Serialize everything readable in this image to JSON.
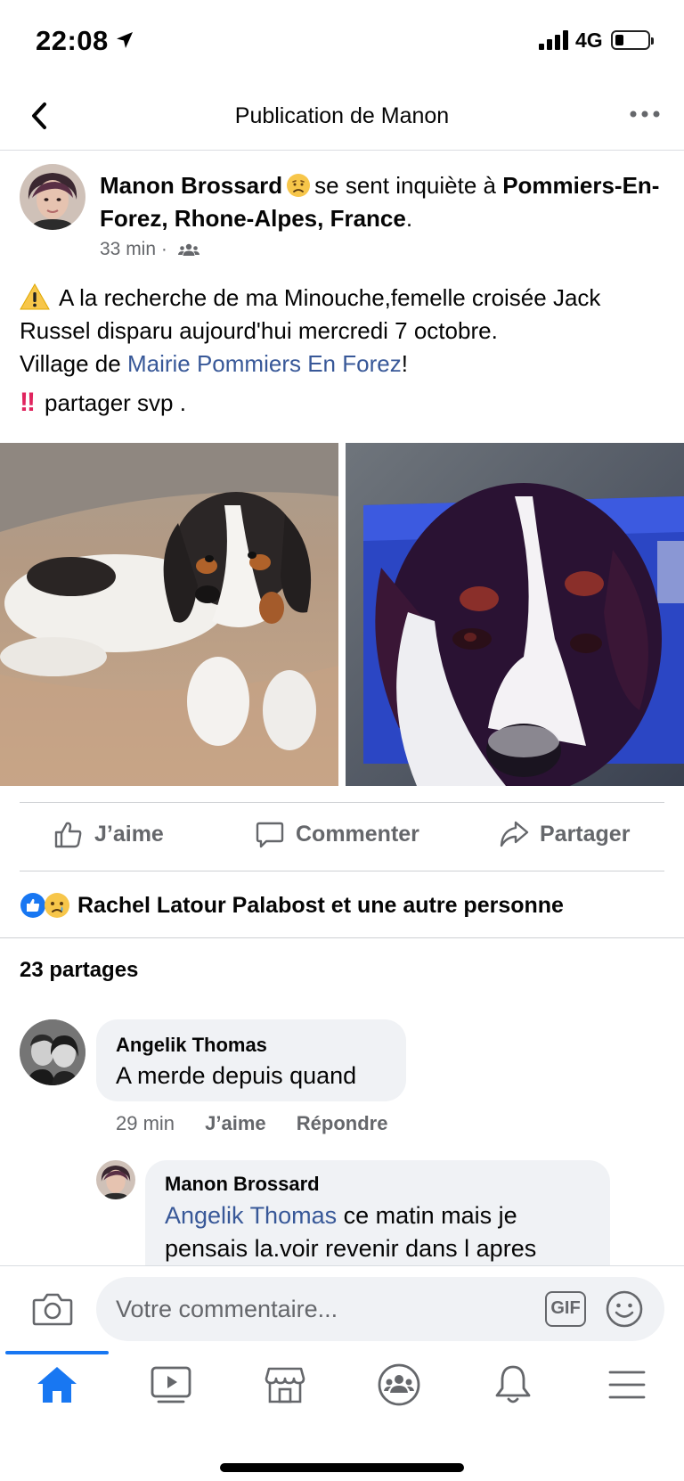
{
  "status_bar": {
    "time": "22:08",
    "network": "4G",
    "signal_bars": 4,
    "battery_level": 0.25
  },
  "nav": {
    "title": "Publication de Manon",
    "back_icon": "chevron-left-icon",
    "more_icon": "more-horizontal-icon"
  },
  "post": {
    "author": "Manon Brossard",
    "feeling": "se sent inquiète à",
    "location": "Pommiers-En-Forez, Rhone-Alpes, France",
    "location_end": ".",
    "time": "33 min",
    "meta_separator": "·",
    "body_line1": "A la recherche de ma Minouche,femelle croisée Jack Russel disparu aujourd'hui mercredi 7 octobre.",
    "body_line2_prefix": "Village de ",
    "body_line2_link": "Mairie Pommiers En Forez",
    "body_line2_suffix": "!",
    "body_line3_bang": "!!",
    "body_line3": "partager svp   ."
  },
  "actions": {
    "like": "J’aime",
    "comment": "Commenter",
    "share": "Partager"
  },
  "reactions": {
    "text": "Rachel Latour Palabost et une autre personne"
  },
  "shares": {
    "text": "23 partages"
  },
  "comments": [
    {
      "author": "Angelik Thomas",
      "text": "A merde depuis quand",
      "time": "29 min",
      "like": "J’aime",
      "reply": "Répondre"
    },
    {
      "author": "Manon Brossard",
      "mention": "Angelik Thomas",
      "text": " ce matin mais je pensais la.voir revenir dans l apres"
    }
  ],
  "composer": {
    "placeholder": "Votre commentaire...",
    "gif": "GIF"
  },
  "colors": {
    "link": "#385898",
    "accent": "#1877f2",
    "secondary_text": "#65676b",
    "bubble": "#f0f2f5"
  }
}
